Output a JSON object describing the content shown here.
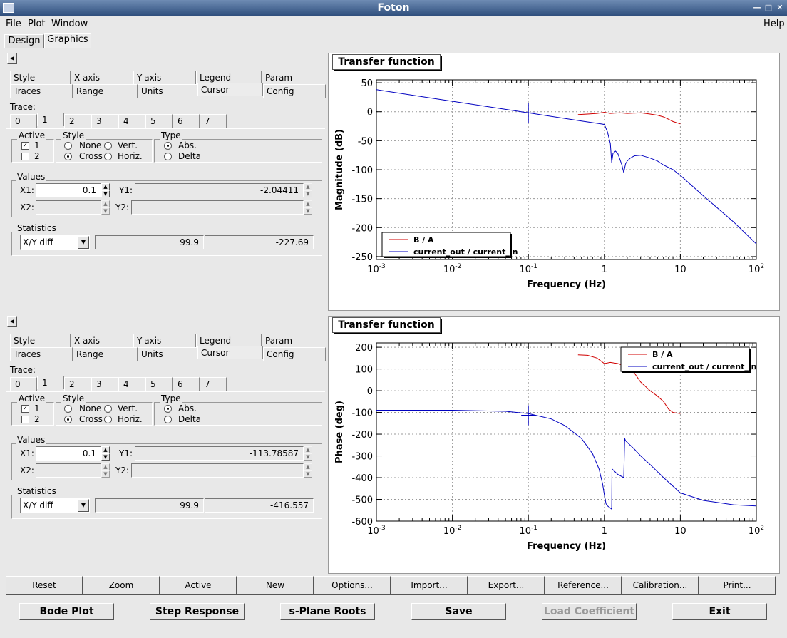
{
  "window": {
    "title": "Foton"
  },
  "menu": {
    "file": "File",
    "plot": "Plot",
    "window": "Window",
    "help": "Help"
  },
  "main_tabs": [
    "Design",
    "Graphics"
  ],
  "panels": [
    {
      "props_tabs_row1": [
        "Style",
        "X-axis",
        "Y-axis",
        "Legend",
        "Param"
      ],
      "props_tabs_row2": [
        "Traces",
        "Range",
        "Units",
        "Cursor",
        "Config"
      ],
      "trace_label": "Trace:",
      "trace_tabs": [
        "0",
        "1",
        "2",
        "3",
        "4",
        "5",
        "6",
        "7"
      ],
      "active_label": "Active",
      "active_1": "1",
      "active_2": "2",
      "style_label": "Style",
      "style_none": "None",
      "style_vert": "Vert.",
      "style_cross": "Cross",
      "style_horiz": "Horiz.",
      "type_label": "Type",
      "type_abs": "Abs.",
      "type_delta": "Delta",
      "values_label": "Values",
      "x1_label": "X1:",
      "x1_value": "0.1",
      "y1_label": "Y1:",
      "y1_value": "-2.04411",
      "x2_label": "X2:",
      "y2_label": "Y2:",
      "stats_label": "Statistics",
      "stats_mode": "X/Y diff",
      "stats_v1": "99.9",
      "stats_v2": "-227.69",
      "plot_title": "Transfer function"
    },
    {
      "props_tabs_row1": [
        "Style",
        "X-axis",
        "Y-axis",
        "Legend",
        "Param"
      ],
      "props_tabs_row2": [
        "Traces",
        "Range",
        "Units",
        "Cursor",
        "Config"
      ],
      "trace_label": "Trace:",
      "trace_tabs": [
        "0",
        "1",
        "2",
        "3",
        "4",
        "5",
        "6",
        "7"
      ],
      "active_label": "Active",
      "active_1": "1",
      "active_2": "2",
      "style_label": "Style",
      "style_none": "None",
      "style_vert": "Vert.",
      "style_cross": "Cross",
      "style_horiz": "Horiz.",
      "type_label": "Type",
      "type_abs": "Abs.",
      "type_delta": "Delta",
      "values_label": "Values",
      "x1_label": "X1:",
      "x1_value": "0.1",
      "y1_label": "Y1:",
      "y1_value": "-113.78587",
      "x2_label": "X2:",
      "y2_label": "Y2:",
      "stats_label": "Statistics",
      "stats_mode": "X/Y diff",
      "stats_v1": "99.9",
      "stats_v2": "-416.557",
      "plot_title": "Transfer function"
    }
  ],
  "bottom_tabs": [
    "Reset",
    "Zoom",
    "Active",
    "New",
    "Options...",
    "Import...",
    "Export...",
    "Reference...",
    "Calibration...",
    "Print..."
  ],
  "action_buttons": [
    "Bode Plot",
    "Step Response",
    "s-Plane Roots",
    "Save",
    "Load Coefficient",
    "Exit"
  ],
  "colors": {
    "series_ba": "#d00000",
    "series_current": "#0000c0"
  },
  "chart_data": [
    {
      "type": "line",
      "xlabel": "Frequency (Hz)",
      "ylabel": "Magnitude (dB)",
      "xscale": "log",
      "xlim": [
        0.001,
        100
      ],
      "ylim": [
        -255,
        55
      ],
      "xticks": [
        "10^-3",
        "10^-2",
        "10^-1",
        "1",
        "10",
        "10^2"
      ],
      "yticks": [
        50,
        0,
        -50,
        -100,
        -150,
        -200,
        -250
      ],
      "grid": true,
      "legend_position": "bottom-left",
      "series": [
        {
          "name": "B / A",
          "color": "#d00000",
          "x": [
            0.45,
            0.6,
            0.8,
            1.0,
            1.2,
            1.6,
            2.0,
            3.0,
            4.0,
            5.0,
            6.0,
            7.0,
            8.0,
            10.0
          ],
          "y": [
            -5,
            -4,
            -3,
            -1,
            -3,
            -2,
            -3,
            -2,
            -4,
            -6,
            -9,
            -13,
            -17,
            -21
          ]
        },
        {
          "name": "current_out / current_in",
          "color": "#0000c0",
          "x": [
            0.001,
            0.01,
            0.1,
            0.5,
            0.9,
            1.0,
            1.1,
            1.2,
            1.25,
            1.3,
            1.4,
            1.5,
            1.6,
            1.7,
            1.8,
            1.9,
            2.0,
            2.2,
            2.5,
            3.0,
            4.0,
            5.0,
            6.0,
            8.0,
            10.0,
            20.0,
            50.0,
            100.0
          ],
          "y": [
            38,
            18,
            -2,
            -16,
            -21,
            -22,
            -35,
            -55,
            -88,
            -72,
            -68,
            -72,
            -82,
            -92,
            -105,
            -90,
            -85,
            -80,
            -76,
            -75,
            -80,
            -85,
            -92,
            -100,
            -110,
            -145,
            -190,
            -228
          ]
        }
      ]
    },
    {
      "type": "line",
      "xlabel": "Frequency (Hz)",
      "ylabel": "Phase (deg)",
      "xscale": "log",
      "xlim": [
        0.001,
        100
      ],
      "ylim": [
        -600,
        220
      ],
      "xticks": [
        "10^-3",
        "10^-2",
        "10^-1",
        "1",
        "10",
        "10^2"
      ],
      "yticks": [
        200,
        100,
        0,
        -100,
        -200,
        -300,
        -400,
        -500,
        -600
      ],
      "grid": true,
      "legend_position": "top-right",
      "series": [
        {
          "name": "B / A",
          "color": "#d00000",
          "x": [
            0.45,
            0.6,
            0.8,
            1.0,
            1.2,
            1.5,
            2.0,
            2.5,
            3.0,
            4.0,
            5.0,
            6.0,
            7.0,
            8.0,
            10.0
          ],
          "y": [
            165,
            163,
            150,
            125,
            130,
            125,
            110,
            80,
            40,
            0,
            -25,
            -50,
            -85,
            -100,
            -105
          ]
        },
        {
          "name": "current_out / current_in",
          "color": "#0000c0",
          "x": [
            0.001,
            0.01,
            0.05,
            0.1,
            0.2,
            0.3,
            0.5,
            0.7,
            0.85,
            0.95,
            1.0,
            1.05,
            1.1,
            1.2,
            1.25,
            1.26,
            1.5,
            1.8,
            1.85,
            1.9,
            2.5,
            3.0,
            4.0,
            6.0,
            10.0,
            20.0,
            50.0,
            100.0
          ],
          "y": [
            -90,
            -90,
            -95,
            -105,
            -130,
            -160,
            -220,
            -290,
            -360,
            -430,
            -480,
            -520,
            -530,
            -540,
            -545,
            -360,
            -385,
            -400,
            -220,
            -230,
            -270,
            -300,
            -340,
            -400,
            -470,
            -505,
            -525,
            -530
          ]
        }
      ]
    }
  ]
}
